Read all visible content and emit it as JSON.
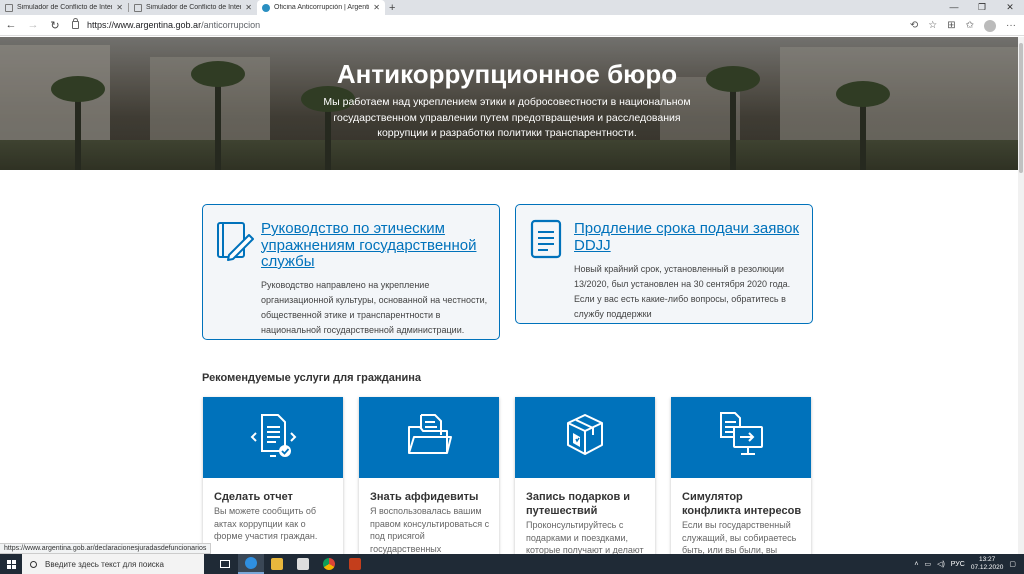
{
  "browser": {
    "tabs": [
      {
        "title": "Simulador de Conflicto de Interés",
        "active": false
      },
      {
        "title": "Simulador de Conflicto de Interés",
        "active": false
      },
      {
        "title": "Oficina Anticorrupción | Argentina",
        "active": true
      }
    ],
    "new_tab_symbol": "+",
    "url_host": "https://www.argentina.gob.ar",
    "url_path": "/anticorrupcion",
    "status_url": "https://www.argentina.gob.ar/declaracionesjuradasdefuncionarios"
  },
  "hero": {
    "title": "Антикоррупционное бюро",
    "subtitle": "Мы работаем над укреплением этики и добросовестности в национальном государственном управлении путем предотвращения и расследования коррупции и разработки политики транспарентности."
  },
  "featured": [
    {
      "title": "Руководство по этическим упражнениям государственной службы",
      "description": "Руководство направлено на укрепление организационной культуры, основанной на честности, общественной этике и транспарентности в национальной государственной администрации.",
      "icon": "book-pencil-icon"
    },
    {
      "title": "Продление срока подачи заявок DDJJ",
      "description": "Новый крайний срок, установленный в резолюции 13/2020, был установлен на 30 сентября 2020 года. Если у вас есть какие-либо вопросы, обратитесь в службу поддержки",
      "icon": "document-icon"
    }
  ],
  "services_title": "Рекомендуемые услуги для гражданина",
  "services": [
    {
      "title": "Сделать отчет",
      "description": "Вы можете сообщить об актах коррупции как о форме участия граждан.",
      "icon": "report-document-icon"
    },
    {
      "title": "Знать аффидевиты",
      "description": "Я воспользовалась вашим правом консультироваться с под присягой государственных",
      "icon": "folder-documents-icon"
    },
    {
      "title": "Запись подарков и путешествий",
      "description": "Проконсультируйтесь с подарками и поездками, которые получают и делают",
      "icon": "gift-box-icon"
    },
    {
      "title": "Симулятор конфликта интересов",
      "description": "Если вы государственный служащий, вы собираетесь быть, или вы были, вы",
      "icon": "monitor-document-icon"
    }
  ],
  "taskbar": {
    "search_placeholder": "Введите здесь текст для поиска",
    "language": "РУС",
    "time": "13:27",
    "date": "07.12.2020"
  },
  "colors": {
    "brand": "#0072bb",
    "card_bg": "#f3f6f9",
    "taskbar": "#1f2a36"
  }
}
